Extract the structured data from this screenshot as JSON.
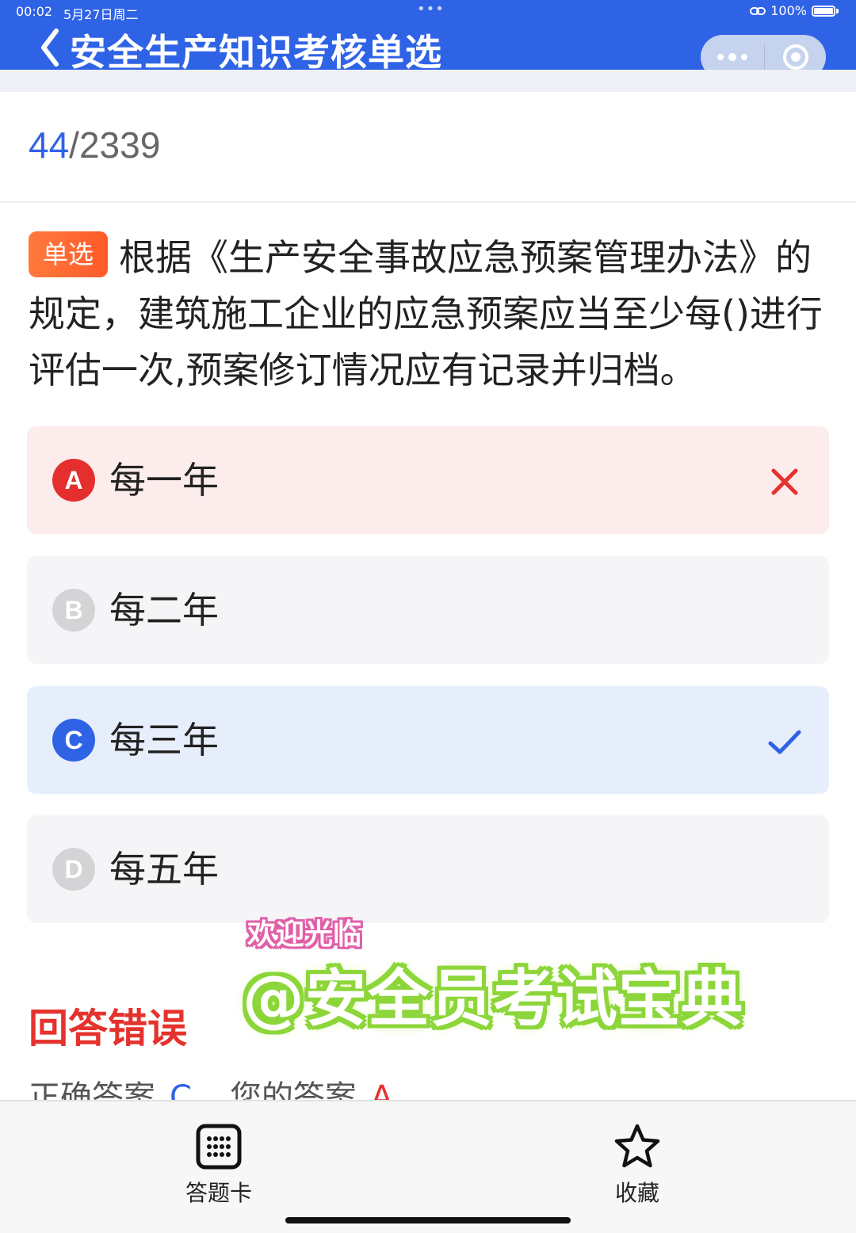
{
  "status_bar": {
    "time": "00:02",
    "date": "5月27日周二",
    "dots": "•••",
    "battery": "100%"
  },
  "header": {
    "title": "安全生产知识考核单选",
    "background": "#2f63e6"
  },
  "progress": {
    "current": "44",
    "separator": "/",
    "total": "2339"
  },
  "question": {
    "type_badge": "单选",
    "text": "根据《生产安全事故应急预案管理办法》的规定，建筑施工企业的应急预案应当至少每()进行评估一次,预案修订情况应有记录并归档。"
  },
  "options": [
    {
      "letter": "A",
      "text": "每一年",
      "state": "wrong"
    },
    {
      "letter": "B",
      "text": "每二年",
      "state": "neutral"
    },
    {
      "letter": "C",
      "text": "每三年",
      "state": "correct"
    },
    {
      "letter": "D",
      "text": "每五年",
      "state": "neutral"
    }
  ],
  "watermark": {
    "line1": "欢迎光临",
    "line2": "@安全员考试宝典"
  },
  "result": {
    "title": "回答错误",
    "correct_label": "正确答案",
    "correct_value": "C",
    "your_label": "您的答案",
    "your_value": "A"
  },
  "bottom_bar": {
    "answer_card_label": "答题卡",
    "favorite_label": "收藏"
  },
  "colors": {
    "accent": "#2f63e6",
    "error": "#e5322d",
    "badge": "#ff6a33"
  }
}
